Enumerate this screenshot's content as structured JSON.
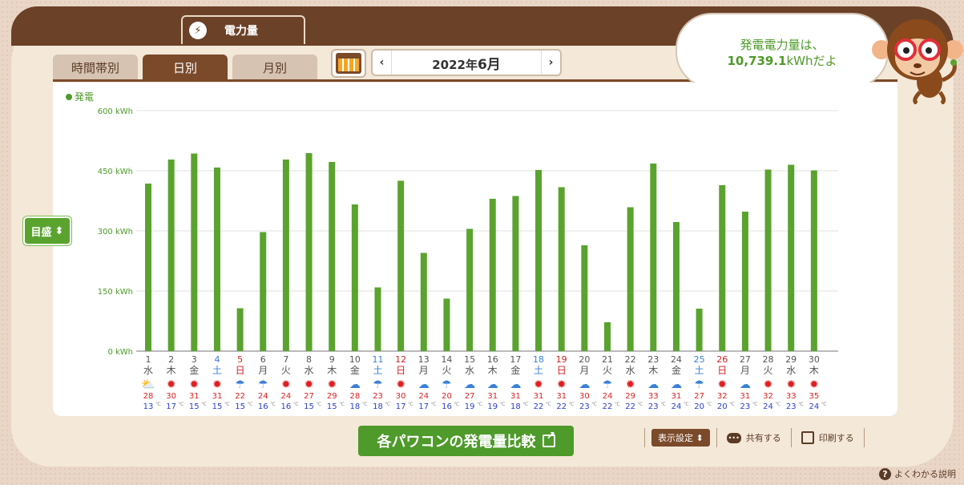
{
  "main_tab": {
    "label": "電力量"
  },
  "tabs": [
    {
      "label": "時間帯別"
    },
    {
      "label": "日別"
    },
    {
      "label": "月別"
    }
  ],
  "date": {
    "year_text": "2022年",
    "month_text": "6月",
    "prev": "‹",
    "next": "›"
  },
  "bubble": {
    "line1": "発電電力量は、",
    "value": "10,739.1",
    "unit_suffix": "kWhだよ"
  },
  "legend": {
    "label": "発電"
  },
  "gauge_button": {
    "label": "目盛",
    "arrows": "⬍"
  },
  "colors": {
    "bar": "#5aa32e",
    "saturday": "#3a7fd9",
    "sunday": "#d62020",
    "max_temp": "#e02020",
    "min_temp": "#2a3fd0"
  },
  "chart_data": {
    "type": "bar",
    "unit": "kWh",
    "ylim": [
      0,
      600
    ],
    "yticks": [
      "0 kWh",
      "150 kWh",
      "300 kWh",
      "450 kWh",
      "600 kWh"
    ],
    "days": [
      "1",
      "2",
      "3",
      "4",
      "5",
      "6",
      "7",
      "8",
      "9",
      "10",
      "11",
      "12",
      "13",
      "14",
      "15",
      "16",
      "17",
      "18",
      "19",
      "20",
      "21",
      "22",
      "23",
      "24",
      "25",
      "26",
      "27",
      "28",
      "29",
      "30"
    ],
    "weekdays": [
      "水",
      "木",
      "金",
      "土",
      "日",
      "月",
      "火",
      "水",
      "木",
      "金",
      "土",
      "日",
      "月",
      "火",
      "水",
      "木",
      "金",
      "土",
      "日",
      "月",
      "火",
      "水",
      "木",
      "金",
      "土",
      "日",
      "月",
      "火",
      "水",
      "木"
    ],
    "values": [
      418,
      478,
      493,
      458,
      107,
      297,
      478,
      494,
      472,
      366,
      159,
      425,
      245,
      131,
      305,
      380,
      387,
      452,
      409,
      264,
      72,
      359,
      468,
      322,
      106,
      414,
      348,
      453,
      465,
      451
    ],
    "weather": [
      "cloudy-sun",
      "sun",
      "sun",
      "sun",
      "rain",
      "rain",
      "sun",
      "sun",
      "sun",
      "cloudy",
      "rain",
      "sun",
      "cloudy",
      "rain",
      "cloudy",
      "cloudy",
      "cloudy",
      "sun",
      "sun",
      "cloudy",
      "rain",
      "sun",
      "cloudy",
      "cloudy",
      "rain",
      "sun",
      "cloudy",
      "sun",
      "sun",
      "sun"
    ],
    "max_temps": [
      "28",
      "30",
      "31",
      "31",
      "22",
      "24",
      "24",
      "27",
      "29",
      "28",
      "23",
      "30",
      "24",
      "20",
      "27",
      "31",
      "31",
      "31",
      "31",
      "30",
      "24",
      "29",
      "33",
      "31",
      "27",
      "32",
      "31",
      "32",
      "33",
      "35"
    ],
    "min_temps": [
      "13",
      "17",
      "15",
      "15",
      "15",
      "16",
      "16",
      "15",
      "15",
      "18",
      "18",
      "17",
      "17",
      "16",
      "19",
      "19",
      "18",
      "22",
      "22",
      "23",
      "22",
      "22",
      "23",
      "24",
      "20",
      "20",
      "23",
      "24",
      "23",
      "24"
    ],
    "temp_unit": "℃"
  },
  "compare_button": {
    "label": "各パワコンの発電量比較"
  },
  "tools": {
    "display": "表示設定 ⬍",
    "share": "共有する",
    "print": "印刷する"
  },
  "help": {
    "label": "よくわかる説明",
    "icon": "?"
  }
}
